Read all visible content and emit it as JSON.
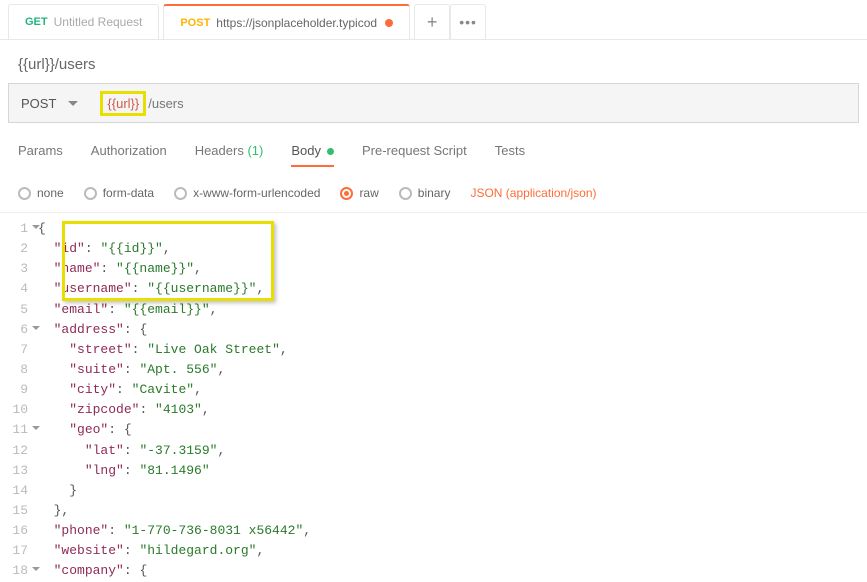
{
  "tabs": [
    {
      "method": "GET",
      "title": "Untitled Request",
      "dirty": false,
      "active": false
    },
    {
      "method": "POST",
      "title": "https://jsonplaceholder.typicod",
      "dirty": true,
      "active": true
    }
  ],
  "add_tab_glyph": "+",
  "more_tab_glyph": "•••",
  "request_name": "{{url}}/users",
  "url_bar": {
    "method": "POST",
    "var": "{{url}}",
    "rest": "/users"
  },
  "section_tabs": {
    "params": "Params",
    "authorization": "Authorization",
    "headers": "Headers",
    "headers_count": "(1)",
    "body": "Body",
    "prerequest": "Pre-request Script",
    "tests": "Tests"
  },
  "body_types": {
    "none": "none",
    "form_data": "form-data",
    "urlencoded": "x-www-form-urlencoded",
    "raw": "raw",
    "binary": "binary",
    "content_type": "JSON (application/json)"
  },
  "code_lines": [
    {
      "n": "1",
      "fold": true,
      "indent": "",
      "segs": [
        [
          "brace",
          "{"
        ]
      ]
    },
    {
      "n": "2",
      "indent": "  ",
      "segs": [
        [
          "key",
          "\"id\""
        ],
        [
          "punc",
          ": "
        ],
        [
          "str",
          "\"{{id}}\""
        ],
        [
          "punc",
          ","
        ]
      ]
    },
    {
      "n": "3",
      "indent": "  ",
      "segs": [
        [
          "key",
          "\"name\""
        ],
        [
          "punc",
          ": "
        ],
        [
          "str",
          "\"{{name}}\""
        ],
        [
          "punc",
          ","
        ]
      ]
    },
    {
      "n": "4",
      "indent": "  ",
      "segs": [
        [
          "key",
          "\"username\""
        ],
        [
          "punc",
          ": "
        ],
        [
          "str",
          "\"{{username}}\""
        ],
        [
          "punc",
          ","
        ]
      ]
    },
    {
      "n": "5",
      "indent": "  ",
      "segs": [
        [
          "key",
          "\"email\""
        ],
        [
          "punc",
          ": "
        ],
        [
          "str",
          "\"{{email}}\""
        ],
        [
          "punc",
          ","
        ]
      ]
    },
    {
      "n": "6",
      "fold": true,
      "indent": "  ",
      "segs": [
        [
          "key",
          "\"address\""
        ],
        [
          "punc",
          ": "
        ],
        [
          "brace",
          "{"
        ]
      ]
    },
    {
      "n": "7",
      "indent": "    ",
      "segs": [
        [
          "key",
          "\"street\""
        ],
        [
          "punc",
          ": "
        ],
        [
          "str",
          "\"Live Oak Street\""
        ],
        [
          "punc",
          ","
        ]
      ]
    },
    {
      "n": "8",
      "indent": "    ",
      "segs": [
        [
          "key",
          "\"suite\""
        ],
        [
          "punc",
          ": "
        ],
        [
          "str",
          "\"Apt. 556\""
        ],
        [
          "punc",
          ","
        ]
      ]
    },
    {
      "n": "9",
      "indent": "    ",
      "segs": [
        [
          "key",
          "\"city\""
        ],
        [
          "punc",
          ": "
        ],
        [
          "str",
          "\"Cavite\""
        ],
        [
          "punc",
          ","
        ]
      ]
    },
    {
      "n": "10",
      "indent": "    ",
      "segs": [
        [
          "key",
          "\"zipcode\""
        ],
        [
          "punc",
          ": "
        ],
        [
          "str",
          "\"4103\""
        ],
        [
          "punc",
          ","
        ]
      ]
    },
    {
      "n": "11",
      "fold": true,
      "indent": "    ",
      "segs": [
        [
          "key",
          "\"geo\""
        ],
        [
          "punc",
          ": "
        ],
        [
          "brace",
          "{"
        ]
      ]
    },
    {
      "n": "12",
      "indent": "      ",
      "segs": [
        [
          "key",
          "\"lat\""
        ],
        [
          "punc",
          ": "
        ],
        [
          "str",
          "\"-37.3159\""
        ],
        [
          "punc",
          ","
        ]
      ]
    },
    {
      "n": "13",
      "indent": "      ",
      "segs": [
        [
          "key",
          "\"lng\""
        ],
        [
          "punc",
          ": "
        ],
        [
          "str",
          "\"81.1496\""
        ]
      ]
    },
    {
      "n": "14",
      "indent": "    ",
      "segs": [
        [
          "brace",
          "}"
        ]
      ]
    },
    {
      "n": "15",
      "indent": "  ",
      "segs": [
        [
          "brace",
          "}"
        ],
        [
          "punc",
          ","
        ]
      ]
    },
    {
      "n": "16",
      "indent": "  ",
      "segs": [
        [
          "key",
          "\"phone\""
        ],
        [
          "punc",
          ": "
        ],
        [
          "str",
          "\"1-770-736-8031 x56442\""
        ],
        [
          "punc",
          ","
        ]
      ]
    },
    {
      "n": "17",
      "indent": "  ",
      "segs": [
        [
          "key",
          "\"website\""
        ],
        [
          "punc",
          ": "
        ],
        [
          "str",
          "\"hildegard.org\""
        ],
        [
          "punc",
          ","
        ]
      ]
    },
    {
      "n": "18",
      "fold": true,
      "indent": "  ",
      "segs": [
        [
          "key",
          "\"company\""
        ],
        [
          "punc",
          ": "
        ],
        [
          "brace",
          "{"
        ]
      ]
    }
  ]
}
